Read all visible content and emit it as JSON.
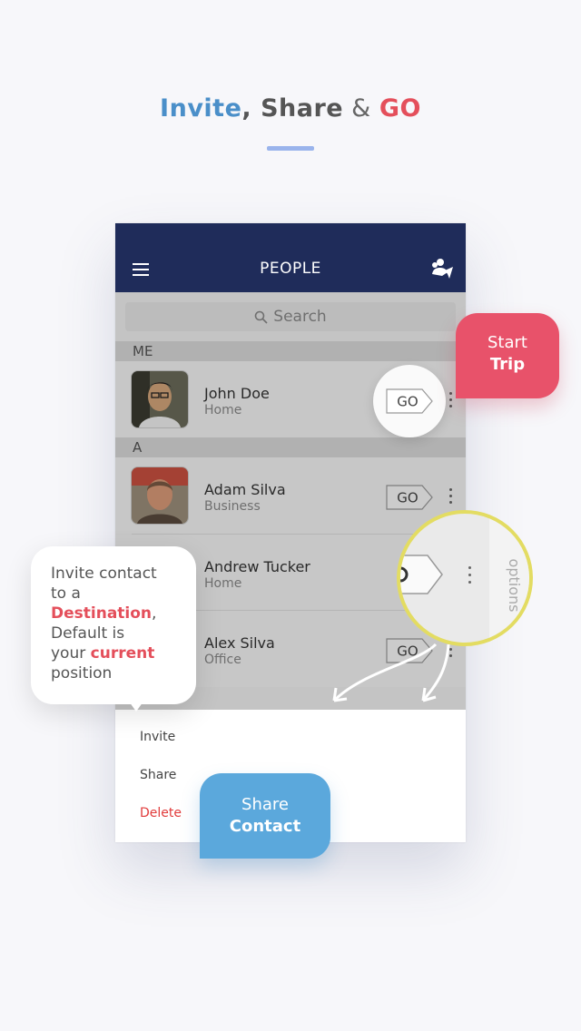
{
  "headline": {
    "part1": "Invite",
    "sep1": ", ",
    "part2": "Share",
    "sep2": " & ",
    "part3": "GO"
  },
  "app": {
    "title": "PEOPLE",
    "search_placeholder": "Search",
    "sections": [
      "ME",
      "A"
    ],
    "contacts": [
      {
        "name": "John Doe",
        "sub": "Home",
        "action": "GO"
      },
      {
        "name": "Adam Silva",
        "sub": "Business",
        "action": "GO"
      },
      {
        "name": "Andrew Tucker",
        "sub": "Home",
        "action": "GO"
      },
      {
        "name": "Alex Silva",
        "sub": "Office",
        "action": "GO"
      }
    ],
    "menu": {
      "invite": "Invite",
      "share": "Share",
      "delete": "Delete"
    },
    "options_label": "options"
  },
  "callouts": {
    "start": {
      "line1": "Start",
      "line2": "Trip"
    },
    "share": {
      "line1": "Share",
      "line2": "Contact"
    },
    "invite": {
      "l1": "Invite contact",
      "l2": "to a",
      "l3_hl": "Destination",
      "l3_tail": ",",
      "l4": "Default is",
      "l5_pre": "your ",
      "l5_hl": "current",
      "l6": "position"
    }
  },
  "colors": {
    "navy": "#1f2c5a",
    "red": "#e8526a",
    "blue": "#5ba8dc",
    "yellow": "#e3dc62"
  }
}
